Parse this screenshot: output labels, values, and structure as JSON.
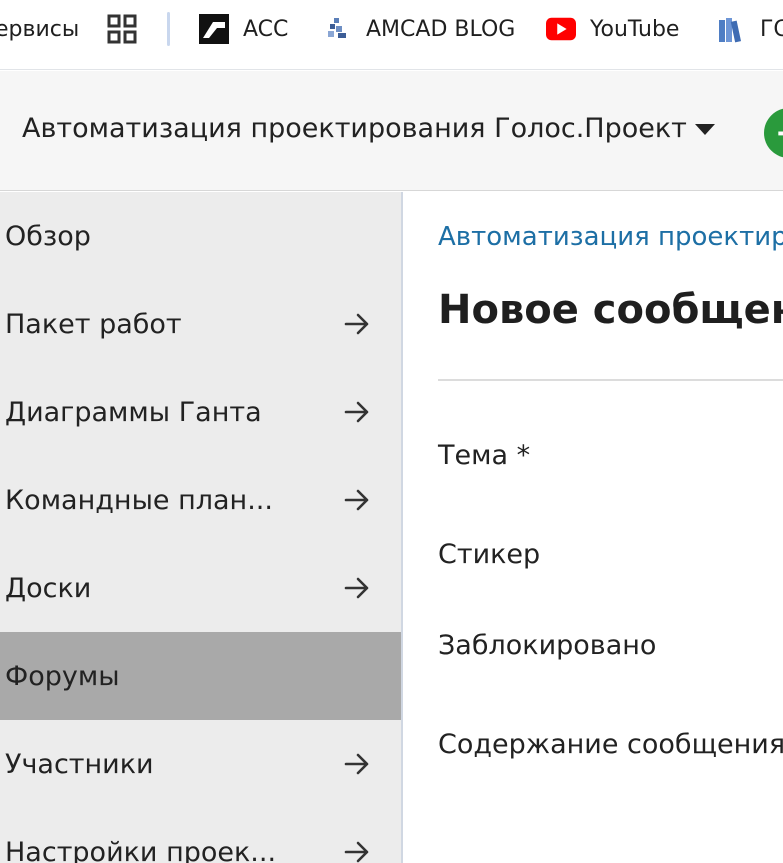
{
  "bookmarks": {
    "items": [
      {
        "label": "ервисы",
        "icon": "apps-text"
      },
      {
        "label": "",
        "icon": "apps-grid-icon"
      },
      {
        "label": "ACC",
        "icon": "acc-logo-icon"
      },
      {
        "label": "AMCAD BLOG",
        "icon": "amcad-logo-icon"
      },
      {
        "label": "YouTube",
        "icon": "youtube-icon"
      },
      {
        "label": "ГС",
        "icon": "books-icon"
      }
    ]
  },
  "project": {
    "title": "Автоматизация проектирования Голос.Проект",
    "add_symbol": "+"
  },
  "sidebar": {
    "items": [
      {
        "label": "Обзор",
        "has_arrow": false,
        "active": false
      },
      {
        "label": "Пакет работ",
        "has_arrow": true,
        "active": false
      },
      {
        "label": "Диаграммы Ганта",
        "has_arrow": true,
        "active": false
      },
      {
        "label": "Командные план...",
        "has_arrow": true,
        "active": false
      },
      {
        "label": "Доски",
        "has_arrow": true,
        "active": false
      },
      {
        "label": "Форумы",
        "has_arrow": false,
        "active": true
      },
      {
        "label": "Участники",
        "has_arrow": true,
        "active": false
      },
      {
        "label": "Настройки проек...",
        "has_arrow": true,
        "active": false
      }
    ]
  },
  "main": {
    "breadcrumb": "Автоматизация проектир",
    "title": "Новое сообщени",
    "fields": {
      "subject": "Тема *",
      "sticker": "Стикер",
      "locked": "Заблокировано",
      "content": "Содержание сообщения"
    }
  },
  "colors": {
    "link": "#1d6fa5",
    "active_sidebar": "#a9a9a9",
    "add_button": "#2a9a3c",
    "youtube_red": "#ff0000"
  }
}
